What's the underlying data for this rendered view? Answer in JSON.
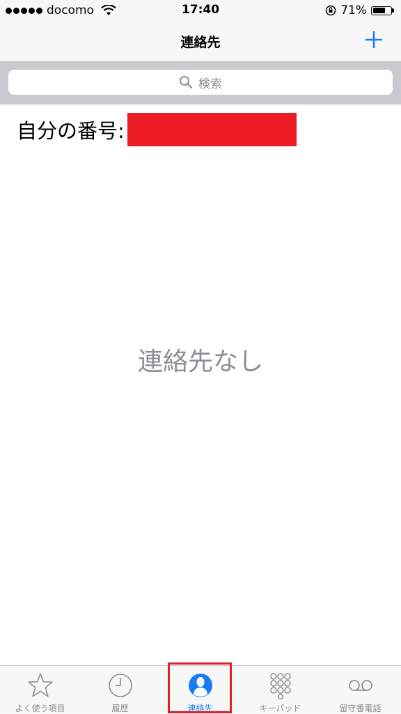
{
  "status_bar": {
    "carrier": "docomo",
    "time": "17:40",
    "battery": "71%",
    "battery_level": 0.71
  },
  "nav": {
    "title": "連絡先",
    "add_icon": "plus-icon"
  },
  "search": {
    "placeholder": "検索",
    "icon": "search-icon"
  },
  "my_number": {
    "label": "自分の番号:"
  },
  "empty_state": "連絡先なし",
  "tabs": [
    {
      "label": "よく使う項目",
      "icon": "star-icon",
      "active": false
    },
    {
      "label": "履歴",
      "icon": "clock-icon",
      "active": false
    },
    {
      "label": "連絡先",
      "icon": "contacts-icon",
      "active": true
    },
    {
      "label": "キーパッド",
      "icon": "keypad-icon",
      "active": false
    },
    {
      "label": "留守番電話",
      "icon": "voicemail-icon",
      "active": false
    }
  ],
  "colors": {
    "accent": "#1a7cf5",
    "redaction": "#ed1c24",
    "highlight": "#e02027"
  }
}
